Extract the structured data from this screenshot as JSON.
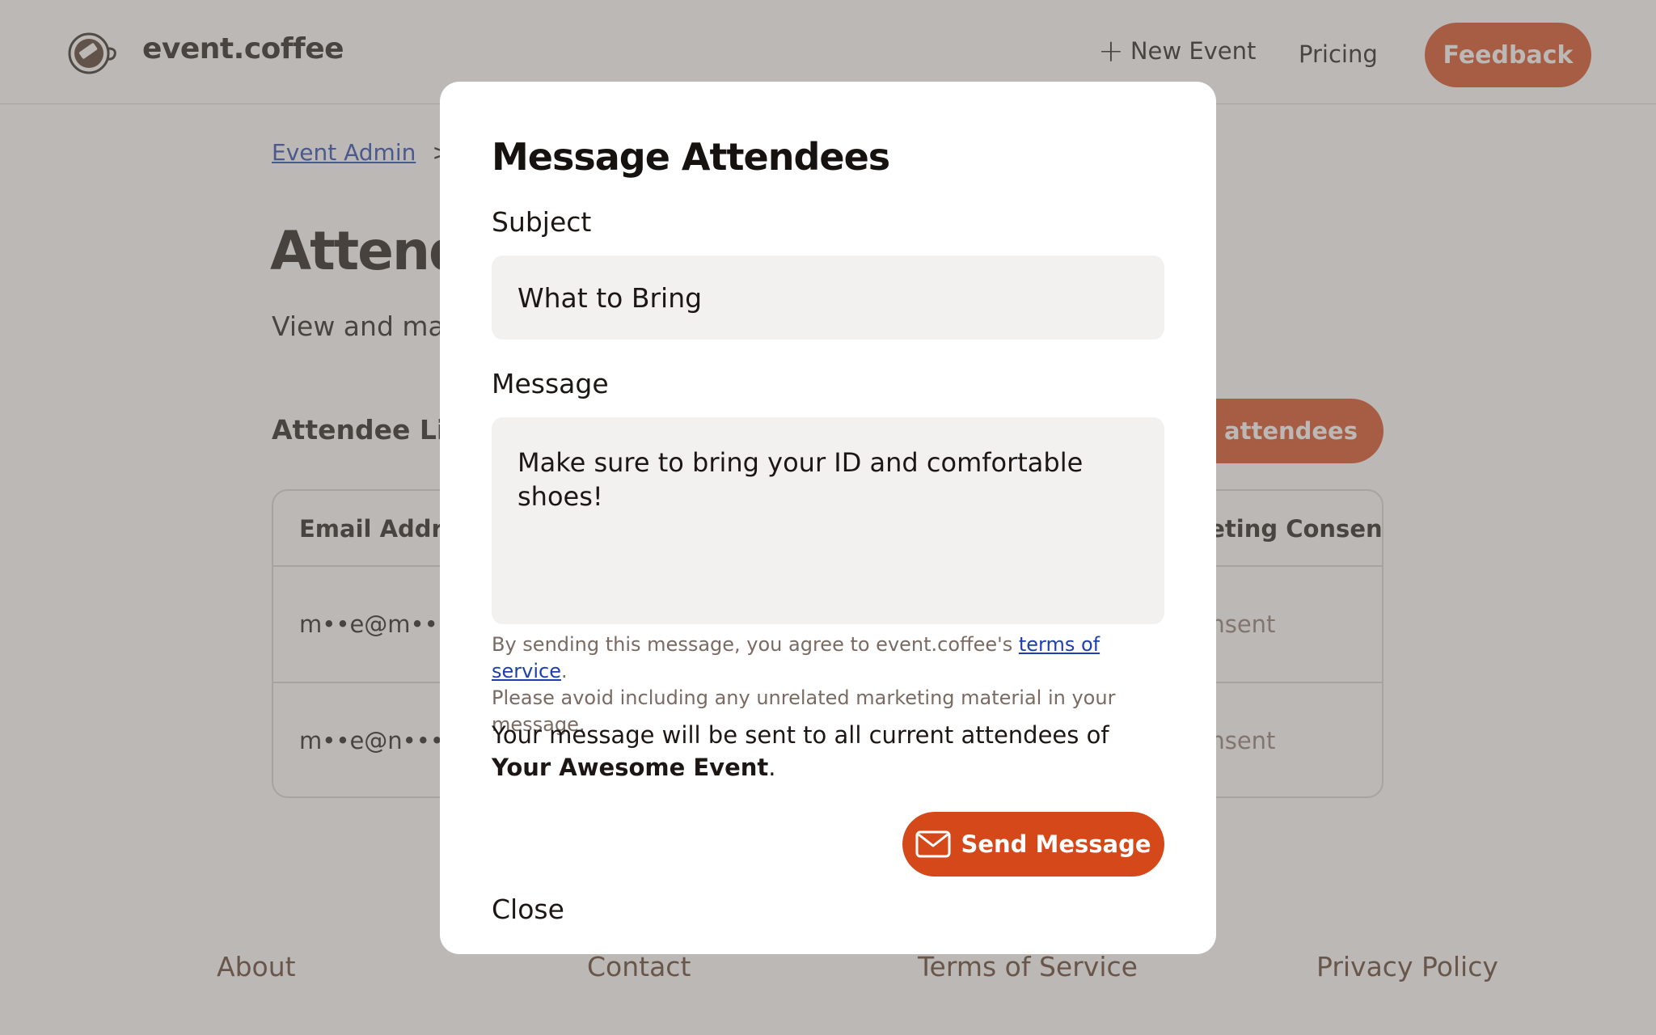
{
  "header": {
    "brand": "event.coffee",
    "new_event": "New Event",
    "pricing": "Pricing",
    "feedback": "Feedback"
  },
  "breadcrumb": {
    "event_admin": "Event Admin",
    "separator": ">"
  },
  "main": {
    "title": "Attendees",
    "subtitle": "View and manage",
    "list_title": "Attendee List",
    "manage_button": "Manage attendees",
    "table": {
      "columns": [
        "Email Address",
        "Marketing Consent"
      ],
      "rows": [
        {
          "email": "m••e@m•••••",
          "consent": "No consent"
        },
        {
          "email": "m••e@n•••w",
          "consent": "No consent"
        }
      ]
    }
  },
  "modal": {
    "title": "Message Attendees",
    "subject_label": "Subject",
    "subject_value": "What to Bring",
    "message_label": "Message",
    "message_value": "Make sure to bring your ID and comfortable shoes!",
    "terms_prefix": "By sending this message, you agree to event.coffee's ",
    "terms_link": "terms of service",
    "terms_suffix": ".",
    "terms_line2": "Please avoid including any unrelated marketing material in your message.",
    "notice_prefix": "Your message will be sent to all current attendees of ",
    "event_name": "Your Awesome Event",
    "notice_suffix": ".",
    "close": "Close",
    "send": "Send Message"
  },
  "footer": {
    "about": "About",
    "contact": "Contact",
    "terms": "Terms of Service",
    "privacy": "Privacy Policy"
  },
  "colors": {
    "accent": "#d4481a",
    "link": "#1e40af",
    "overlay": "rgba(120,114,108,0.5)"
  }
}
